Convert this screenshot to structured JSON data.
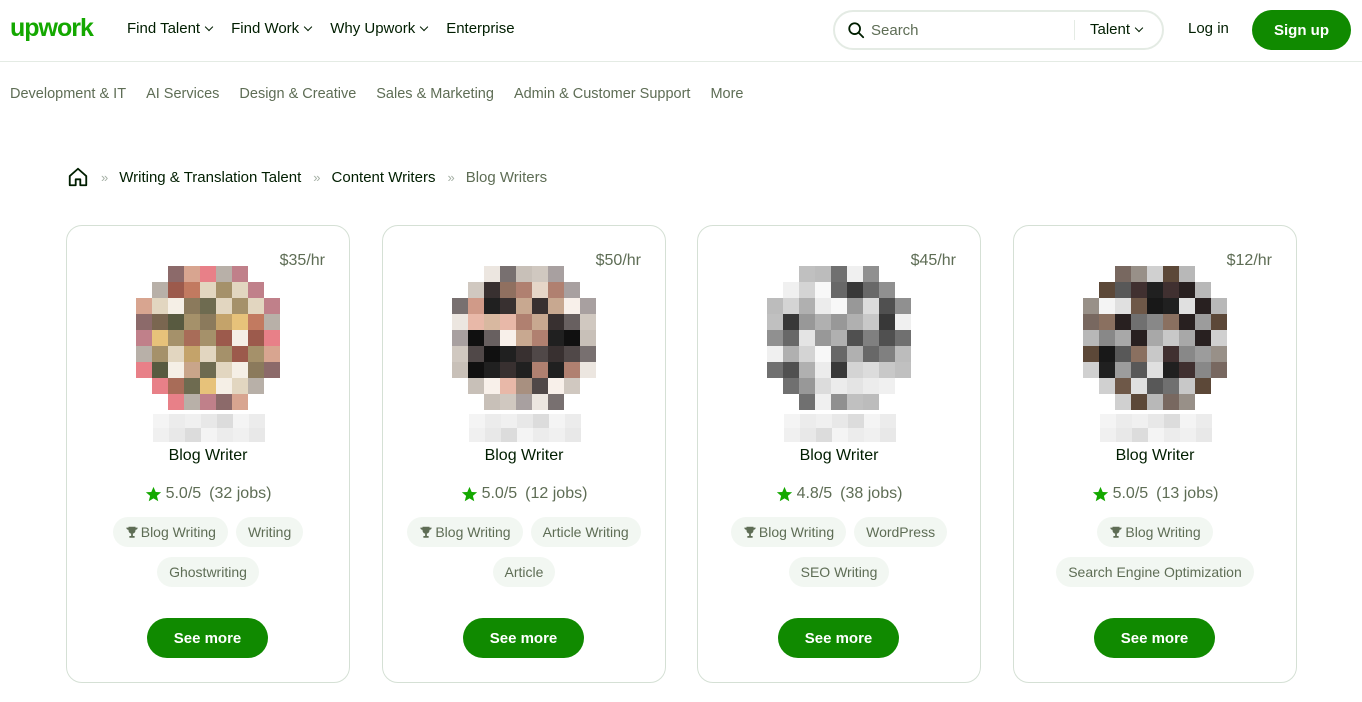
{
  "header": {
    "logo": "upwork",
    "nav": [
      {
        "label": "Find Talent",
        "dropdown": true
      },
      {
        "label": "Find Work",
        "dropdown": true
      },
      {
        "label": "Why Upwork",
        "dropdown": true
      },
      {
        "label": "Enterprise",
        "dropdown": false
      }
    ],
    "search": {
      "placeholder": "Search",
      "type_label": "Talent"
    },
    "login_label": "Log in",
    "signup_label": "Sign up"
  },
  "categories": [
    "Development & IT",
    "AI Services",
    "Design & Creative",
    "Sales & Marketing",
    "Admin & Customer Support",
    "More"
  ],
  "breadcrumb": {
    "links": [
      "Writing & Translation Talent",
      "Content Writers"
    ],
    "current": "Blog Writers",
    "separator": "»"
  },
  "cards": [
    {
      "rate": "$35/hr",
      "title": "Blog Writer",
      "rating": "5.0/5",
      "jobs": "(32 jobs)",
      "skills": [
        {
          "label": "Blog Writing",
          "top": true
        },
        {
          "label": "Writing",
          "top": false
        },
        {
          "label": "Ghostwriting",
          "top": false
        }
      ],
      "button": "See more"
    },
    {
      "rate": "$50/hr",
      "title": "Blog Writer",
      "rating": "5.0/5",
      "jobs": "(12 jobs)",
      "skills": [
        {
          "label": "Blog Writing",
          "top": true
        },
        {
          "label": "Article Writing",
          "top": false
        },
        {
          "label": "Article",
          "top": false
        }
      ],
      "button": "See more"
    },
    {
      "rate": "$45/hr",
      "title": "Blog Writer",
      "rating": "4.8/5",
      "jobs": "(38 jobs)",
      "skills": [
        {
          "label": "Blog Writing",
          "top": true
        },
        {
          "label": "WordPress",
          "top": false
        },
        {
          "label": "SEO Writing",
          "top": false
        }
      ],
      "button": "See more"
    },
    {
      "rate": "$12/hr",
      "title": "Blog Writer",
      "rating": "5.0/5",
      "jobs": "(13 jobs)",
      "skills": [
        {
          "label": "Blog Writing",
          "top": true
        },
        {
          "label": "Search Engine Optimization",
          "top": false
        }
      ],
      "button": "See more"
    }
  ],
  "colors": {
    "brand_green": "#14a800",
    "button_green": "#108a00",
    "star_green": "#14a800",
    "text_dark": "#001e00",
    "text_muted": "#5e6d55",
    "chip_bg": "#f2f7f2",
    "border": "#d5e0d5"
  },
  "avatar_palettes": [
    [
      "#f5efe6",
      "#e2d6c0",
      "#c4a36a",
      "#e7c27a",
      "#a5916a",
      "#8b7a5c",
      "#6e6b50",
      "#c9a58a",
      "#b98a6a",
      "#a86c58",
      "#7a6650",
      "#585a40",
      "#c27a60",
      "#9c5a4c",
      "#d8a590",
      "#c0808a",
      "#e88088",
      "#8c6a6a",
      "#b8b0a8",
      "#d8d0d0"
    ],
    [
      "#f8f0ea",
      "#e6d6c8",
      "#d8b8a0",
      "#c8a890",
      "#b08070",
      "#e8b8a8",
      "#d09a88",
      "#907060",
      "#a89080",
      "#202020",
      "#383030",
      "#504848",
      "#101010",
      "#686060",
      "#c8c0b8",
      "#ece6e0",
      "#d0c8c0",
      "#787070",
      "#a8a0a0",
      "#e0d8d0"
    ],
    [
      "#f8f8f8",
      "#ececec",
      "#dcdcdc",
      "#c8c8c8",
      "#b0b0b0",
      "#989898",
      "#808080",
      "#686868",
      "#e4e4e4",
      "#d4d4d4",
      "#a0a0a0",
      "#505050",
      "#383838",
      "#282828",
      "#f0f0f0",
      "#bcbcbc",
      "#909090",
      "#707070",
      "#c0c0c0",
      "#e8e8e8"
    ],
    [
      "#f4f4f4",
      "#e0e0e0",
      "#c8c8c8",
      "#a8a8a8",
      "#888888",
      "#707070",
      "#585858",
      "#8a7060",
      "#6e5848",
      "#403030",
      "#282020",
      "#181818",
      "#202020",
      "#9c9c9c",
      "#b8b8b8",
      "#d0d0d0",
      "#786860",
      "#5c4838",
      "#989088",
      "#e8e8e8"
    ]
  ]
}
